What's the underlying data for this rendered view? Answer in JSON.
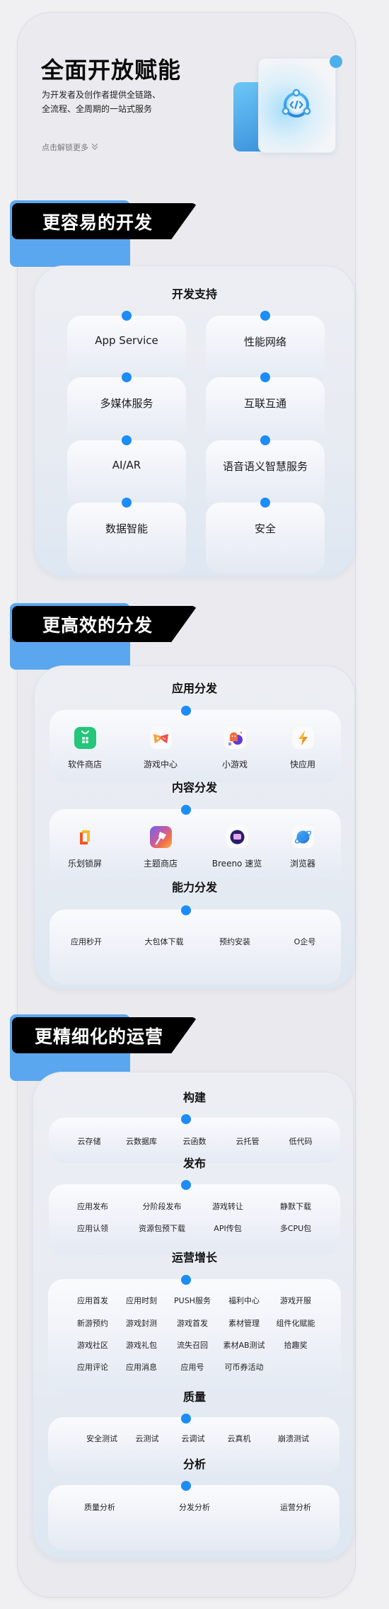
{
  "hero": {
    "title": "全面开放赋能",
    "subtitle_line1": "为开发者及创作者提供全链路、",
    "subtitle_line2": "全流程、全周期的一站式服务",
    "more_label": "点击解锁更多",
    "more_icon": "double-chevron-down-icon",
    "illustration_icon": "code-hub-icon"
  },
  "colors": {
    "accent": "#1c8cf7",
    "banner_blue": "#5aa7f0",
    "banner_black": "#000000",
    "app_store_green": "#22c77a"
  },
  "sections": [
    {
      "title": "更容易的开发",
      "groups": [
        {
          "title": "开发支持",
          "tiles": [
            "App Service",
            "性能网络",
            "多媒体服务",
            "互联互通",
            "AI/AR",
            "语音语义智慧服务",
            "数据智能",
            "安全"
          ]
        }
      ]
    },
    {
      "title": "更高效的分发",
      "groups": [
        {
          "title": "应用分发",
          "apps": [
            {
              "name": "软件商店",
              "icon": "app-store-icon"
            },
            {
              "name": "游戏中心",
              "icon": "game-center-icon"
            },
            {
              "name": "小游戏",
              "icon": "mini-game-icon"
            },
            {
              "name": "快应用",
              "icon": "quick-app-icon"
            }
          ]
        },
        {
          "title": "内容分发",
          "apps": [
            {
              "name": "乐划锁屏",
              "icon": "lock-screen-icon"
            },
            {
              "name": "主题商店",
              "icon": "theme-store-icon"
            },
            {
              "name": "Breeno 速览",
              "icon": "breeno-icon"
            },
            {
              "name": "浏览器",
              "icon": "browser-icon"
            }
          ]
        },
        {
          "title": "能力分发",
          "items": [
            "应用秒开",
            "大包体下载",
            "预约安装",
            "O企号"
          ]
        }
      ]
    },
    {
      "title": "更精细化的运营",
      "groups": [
        {
          "title": "构建",
          "items": [
            "云存储",
            "云数据库",
            "云函数",
            "云托管",
            "低代码"
          ]
        },
        {
          "title": "发布",
          "items": [
            "应用发布",
            "分阶段发布",
            "游戏转让",
            "静默下载",
            "应用认领",
            "资源包预下载",
            "API传包",
            "多CPU包"
          ]
        },
        {
          "title": "运营增长",
          "items": [
            "应用首发",
            "应用时刻",
            "PUSH服务",
            "福利中心",
            "游戏开服",
            "新游预约",
            "游戏封测",
            "游戏首发",
            "素材管理",
            "组件化赋能",
            "游戏社区",
            "游戏礼包",
            "流失召回",
            "素材AB测试",
            "拾趣奖",
            "应用评论",
            "应用消息",
            "应用号",
            "可币券活动"
          ]
        },
        {
          "title": "质量",
          "items": [
            "安全测试",
            "云测试",
            "云调试",
            "云真机",
            "崩溃测试"
          ]
        },
        {
          "title": "分析",
          "items": [
            "质量分析",
            "分发分析",
            "运营分析"
          ]
        }
      ]
    }
  ]
}
